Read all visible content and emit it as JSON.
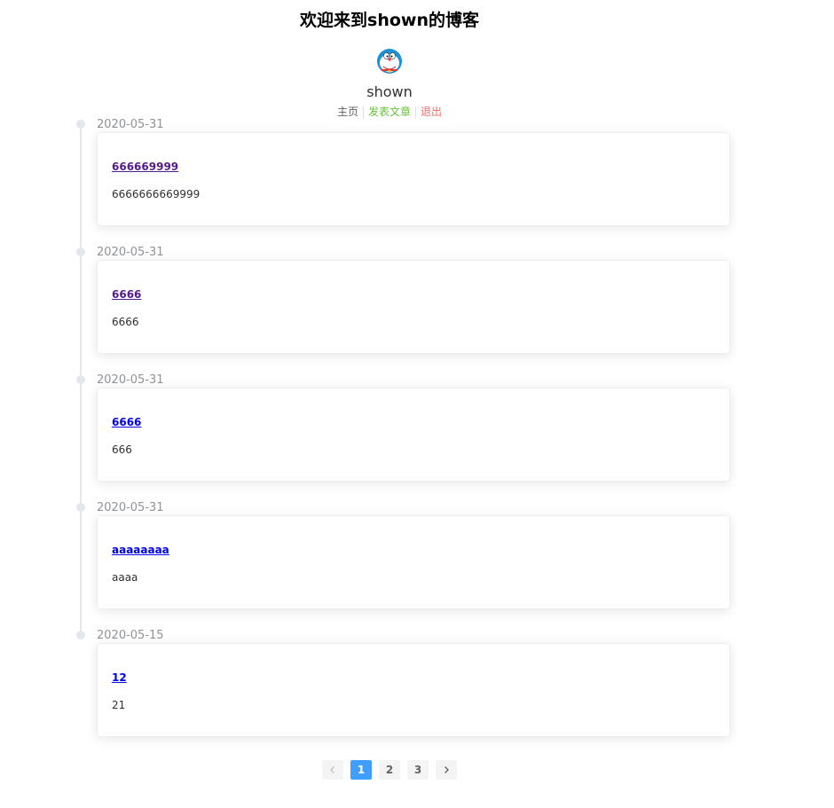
{
  "header": {
    "title": "欢迎来到shown的博客",
    "username": "shown",
    "nav": {
      "home": "主页",
      "publish": "发表文章",
      "logout": "退出"
    }
  },
  "posts": [
    {
      "date": "2020-05-31",
      "title": "666669999",
      "content": "6666666669999",
      "visited": true
    },
    {
      "date": "2020-05-31",
      "title": "6666",
      "content": "6666",
      "visited": true
    },
    {
      "date": "2020-05-31",
      "title": "6666",
      "content": "666",
      "visited": false
    },
    {
      "date": "2020-05-31",
      "title": "aaaaaaaa",
      "content": "aaaa",
      "visited": false
    },
    {
      "date": "2020-05-15",
      "title": "12",
      "content": "21",
      "visited": false
    }
  ],
  "pagination": {
    "pages": [
      "1",
      "2",
      "3"
    ],
    "current": "1",
    "prev_icon": "chevron-left-icon",
    "next_icon": "chevron-right-icon"
  },
  "colors": {
    "accent": "#409eff",
    "publish": "#67c23a",
    "logout": "#f56c6c",
    "timeline": "#e4e7ed"
  }
}
